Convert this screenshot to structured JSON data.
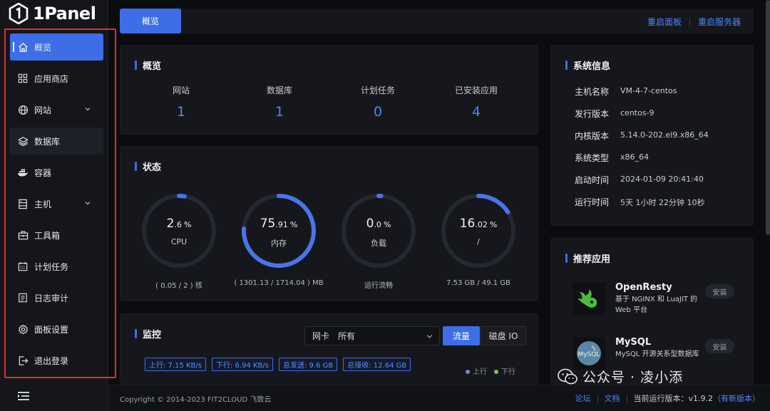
{
  "brand": {
    "name": "1Panel"
  },
  "sidebar": {
    "items": [
      {
        "label": "概览",
        "icon": "home-icon",
        "active": true
      },
      {
        "label": "应用商店",
        "icon": "apps-grid-icon"
      },
      {
        "label": "网站",
        "icon": "globe-icon",
        "expandable": true
      },
      {
        "label": "数据库",
        "icon": "layers-icon"
      },
      {
        "label": "容器",
        "icon": "docker-whale-icon"
      },
      {
        "label": "主机",
        "icon": "server-icon",
        "expandable": true
      },
      {
        "label": "工具箱",
        "icon": "toolbox-icon"
      },
      {
        "label": "计划任务",
        "icon": "calendar-icon"
      },
      {
        "label": "日志审计",
        "icon": "log-icon"
      },
      {
        "label": "面板设置",
        "icon": "gear-icon"
      },
      {
        "label": "退出登录",
        "icon": "logout-icon"
      }
    ]
  },
  "topbar": {
    "tab_label": "概览",
    "restart_panel": "重启面板",
    "restart_server": "重启服务器"
  },
  "overview": {
    "title": "概览",
    "stats": [
      {
        "label": "网站",
        "value": "1"
      },
      {
        "label": "数据库",
        "value": "1"
      },
      {
        "label": "计划任务",
        "value": "0"
      },
      {
        "label": "已安装应用",
        "value": "4"
      }
    ]
  },
  "status": {
    "title": "状态",
    "gauges": [
      {
        "int": "2",
        "dec": ".6",
        "unit": "%",
        "name": "CPU",
        "sub": "( 0.05 / 2 ) 核",
        "percent": 2.6
      },
      {
        "int": "75",
        "dec": ".91",
        "unit": "%",
        "name": "内存",
        "sub": "( 1301.13 / 1714.04 ) MB",
        "percent": 75.91
      },
      {
        "int": "0",
        "dec": ".0",
        "unit": "%",
        "name": "负载",
        "sub": "运行流畅",
        "percent": 0
      },
      {
        "int": "16",
        "dec": ".02",
        "unit": "%",
        "name": "/",
        "sub": "7.53 GB / 49.1 GB",
        "percent": 16.02
      }
    ]
  },
  "monitor": {
    "title": "监控",
    "nic_label": "网卡",
    "nic_value": "所有",
    "seg_traffic": "流量",
    "seg_disk": "磁盘 IO",
    "tags": [
      "上行: 7.15 KB/s",
      "下行: 6.94 KB/s",
      "总发送: 9.6 GB",
      "总接收: 12.64 GB"
    ],
    "legend_up": "上行",
    "legend_down": "下行",
    "colors": {
      "up": "#6f86d6",
      "down": "#7cc16a"
    }
  },
  "system": {
    "title": "系统信息",
    "rows": [
      {
        "key": "主机名称",
        "value": "VM-4-7-centos"
      },
      {
        "key": "发行版本",
        "value": "centos-9"
      },
      {
        "key": "内核版本",
        "value": "5.14.0-202.el9.x86_64"
      },
      {
        "key": "系统类型",
        "value": "x86_64"
      },
      {
        "key": "启动时间",
        "value": "2024-01-09 20:41:40"
      },
      {
        "key": "运行时间",
        "value": "5天 1小时 22分钟 10秒"
      }
    ]
  },
  "recommended": {
    "title": "推荐应用",
    "apps": [
      {
        "name": "OpenResty",
        "desc": "基于 NGINX 和 LuaJIT 的 Web 平台",
        "button": "安装",
        "icon": "openresty-logo-icon"
      },
      {
        "name": "MySQL",
        "desc": "MySQL 开源关系型数据库",
        "button": "安装",
        "icon": "mysql-logo-icon",
        "logo_text": "MySQL"
      }
    ]
  },
  "footer": {
    "copyright": "Copyright © 2014-2023 FIT2CLOUD 飞致云",
    "forum": "论坛",
    "docs": "文档",
    "version_label": "当前运行版本：",
    "version": "v1.9.2",
    "new_version": "（有新版本）"
  },
  "watermark": {
    "text": "公众号 · 凌小添"
  },
  "colors": {
    "accent": "#3d6ee6",
    "highlight_border": "#e0302a"
  }
}
